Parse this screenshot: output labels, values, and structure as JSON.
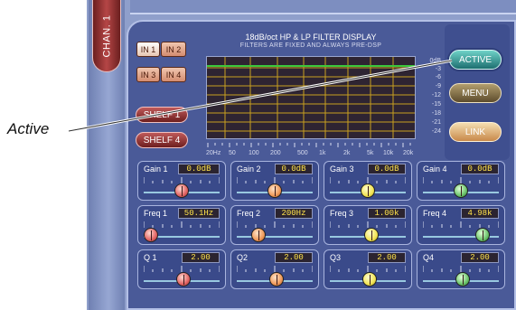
{
  "channel_tab": "CHAN. 1",
  "inputs": [
    "IN 1",
    "IN 2",
    "IN 3",
    "IN 4"
  ],
  "shelf_buttons": [
    "SHELF 1",
    "SHELF 4"
  ],
  "graph": {
    "title": "18dB/oct  HP & LP FILTER DISPLAY",
    "subtitle": "FILTERS ARE FIXED AND ALWAYS PRE-DSP",
    "db_scale": [
      "0dB",
      "-3",
      "-6",
      "-9",
      "-12",
      "-15",
      "-18",
      "-21",
      "-24"
    ],
    "freq_labels": [
      "20Hz",
      "50",
      "100",
      "200",
      "500",
      "1k",
      "2k",
      "5k",
      "10k",
      "20k"
    ]
  },
  "right_buttons": {
    "active": "ACTIVE",
    "menu": "MENU",
    "link": "LINK"
  },
  "bands": [
    {
      "gain_label": "Gain 1",
      "gain": "0.0dB",
      "freq_label": "Freq 1",
      "freq": "50.1Hz",
      "q_label": "Q 1",
      "q": "2.00"
    },
    {
      "gain_label": "Gain 2",
      "gain": "0.0dB",
      "freq_label": "Freq 2",
      "freq": "200Hz",
      "q_label": "Q2",
      "q": "2.00"
    },
    {
      "gain_label": "Gain 3",
      "gain": "0.0dB",
      "freq_label": "Freq 3",
      "freq": "1.00k",
      "q_label": "Q3",
      "q": "2.00"
    },
    {
      "gain_label": "Gain 4",
      "gain": "0.0dB",
      "freq_label": "Freq 4",
      "freq": "4.98k",
      "q_label": "Q4",
      "q": "2.00"
    }
  ],
  "callout": "Active",
  "colors": {
    "panel": "#4a5a98",
    "active_button": "#2f9b95",
    "graph_bg": "#2e2432",
    "flat_line": "#3cc83c",
    "grid": "#c8a020"
  }
}
